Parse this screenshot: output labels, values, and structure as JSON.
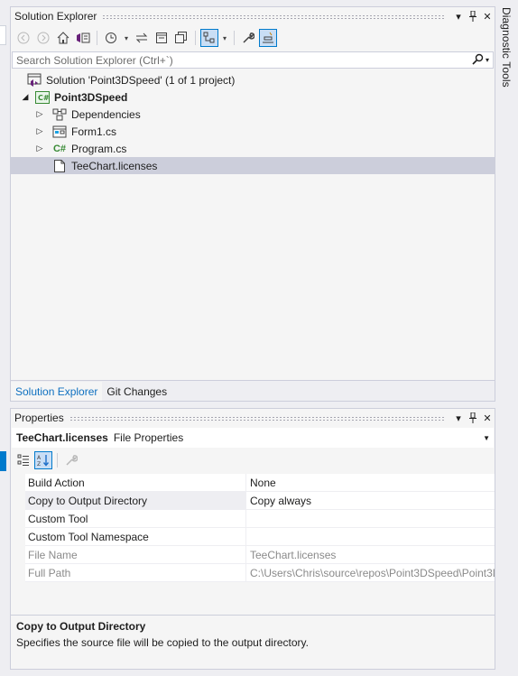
{
  "diagnostic_tools_label": "Diagnostic Tools",
  "solution_explorer": {
    "title": "Solution Explorer",
    "title_buttons": {
      "dropdown": "▾",
      "pin": "📌",
      "close": "✕"
    },
    "search_placeholder": "Search Solution Explorer (Ctrl+`)",
    "tree": [
      {
        "label": "Solution 'Point3DSpeed' (1 of 1 project)",
        "icon": "solution-icon",
        "level": 0
      },
      {
        "label": "Point3DSpeed",
        "icon": "csharp-project-icon",
        "level": 1,
        "bold": true,
        "expanded": true
      },
      {
        "label": "Dependencies",
        "icon": "dependencies-icon",
        "level": 2
      },
      {
        "label": "Form1.cs",
        "icon": "form-icon",
        "level": 2
      },
      {
        "label": "Program.cs",
        "icon": "csharp-file-icon",
        "level": 2
      },
      {
        "label": "TeeChart.licenses",
        "icon": "file-icon",
        "level": 2,
        "selected": true
      }
    ],
    "tabs": [
      "Solution Explorer",
      "Git Changes"
    ],
    "active_tab": "Solution Explorer"
  },
  "properties": {
    "title": "Properties",
    "object_name": "TeeChart.licenses",
    "object_type": "File Properties",
    "rows": [
      {
        "name": "Build Action",
        "value": "None"
      },
      {
        "name": "Copy to Output Directory",
        "value": "Copy always",
        "selected": true
      },
      {
        "name": "Custom Tool",
        "value": ""
      },
      {
        "name": "Custom Tool Namespace",
        "value": ""
      },
      {
        "name": "File Name",
        "value": "TeeChart.licenses",
        "readonly": true
      },
      {
        "name": "Full Path",
        "value": "C:\\Users\\Chris\\source\\repos\\Point3DSpeed\\Point3D",
        "readonly": true
      }
    ],
    "description_title": "Copy to Output Directory",
    "description_text": "Specifies the source file will be copied to the output directory."
  },
  "colors": {
    "accent": "#007acc",
    "selection": "#cccedb",
    "tab_active_text": "#0e70c0"
  }
}
